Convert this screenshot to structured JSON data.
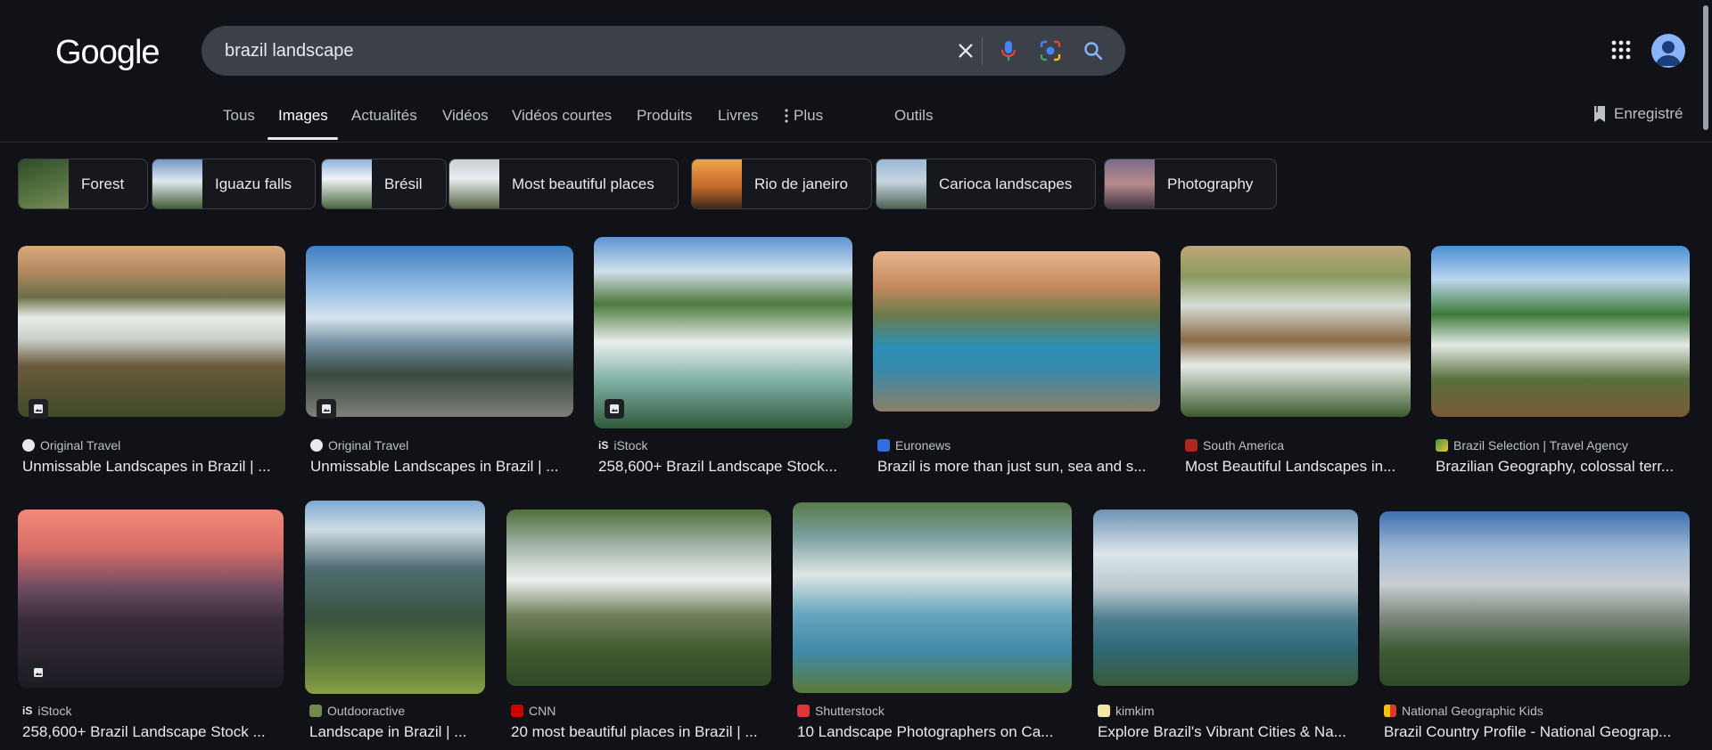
{
  "logo": "Google",
  "search": {
    "query": "brazil landscape"
  },
  "tabs": [
    "Tous",
    "Images",
    "Actualités",
    "Vidéos",
    "Vidéos courtes",
    "Produits",
    "Livres",
    "Plus",
    "Outils"
  ],
  "saved_label": "Enregistré",
  "chips": [
    "Forest",
    "Iguazu falls",
    "Brésil",
    "Most beautiful places",
    "Rio de janeiro",
    "Carioca landscapes",
    "Photography"
  ],
  "results_row1": [
    {
      "source": "Original Travel",
      "title": "Unmissable Landscapes in Brazil | ..."
    },
    {
      "source": "Original Travel",
      "title": "Unmissable Landscapes in Brazil | ..."
    },
    {
      "source": "iStock",
      "title": "258,600+ Brazil Landscape Stock..."
    },
    {
      "source": "Euronews",
      "title": "Brazil is more than just sun, sea and s..."
    },
    {
      "source": "South America",
      "title": "Most Beautiful Landscapes in..."
    },
    {
      "source": "Brazil Selection | Travel Agency",
      "title": "Brazilian Geography, colossal terr..."
    }
  ],
  "results_row2": [
    {
      "source": "iStock",
      "title": "258,600+ Brazil Landscape Stock ..."
    },
    {
      "source": "Outdooractive",
      "title": "Landscape in Brazil | ..."
    },
    {
      "source": "CNN",
      "title": "20 most beautiful places in Brazil | ..."
    },
    {
      "source": "Shutterstock",
      "title": "10 Landscape Photographers on Ca..."
    },
    {
      "source": "kimkim",
      "title": "Explore Brazil's Vibrant Cities & Na..."
    },
    {
      "source": "National Geographic Kids",
      "title": "Brazil Country Profile - National Geograp..."
    }
  ]
}
